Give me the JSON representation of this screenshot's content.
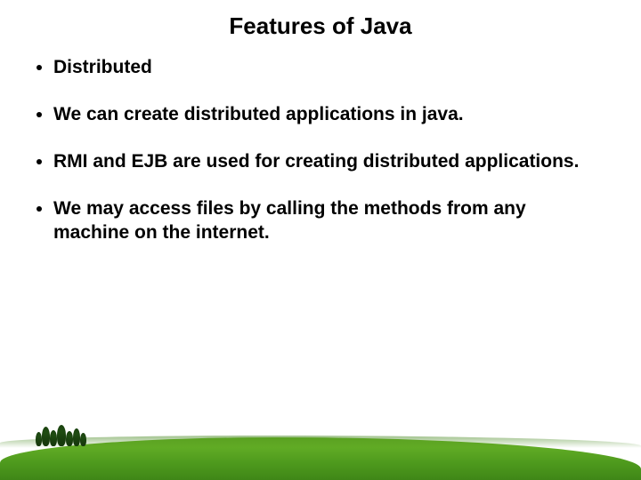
{
  "title": "Features of Java",
  "bullets": [
    "Distributed",
    "We can create distributed applications in java.",
    " RMI and EJB are used for creating distributed applications.",
    "We may access files by calling the methods from any machine on the internet."
  ]
}
